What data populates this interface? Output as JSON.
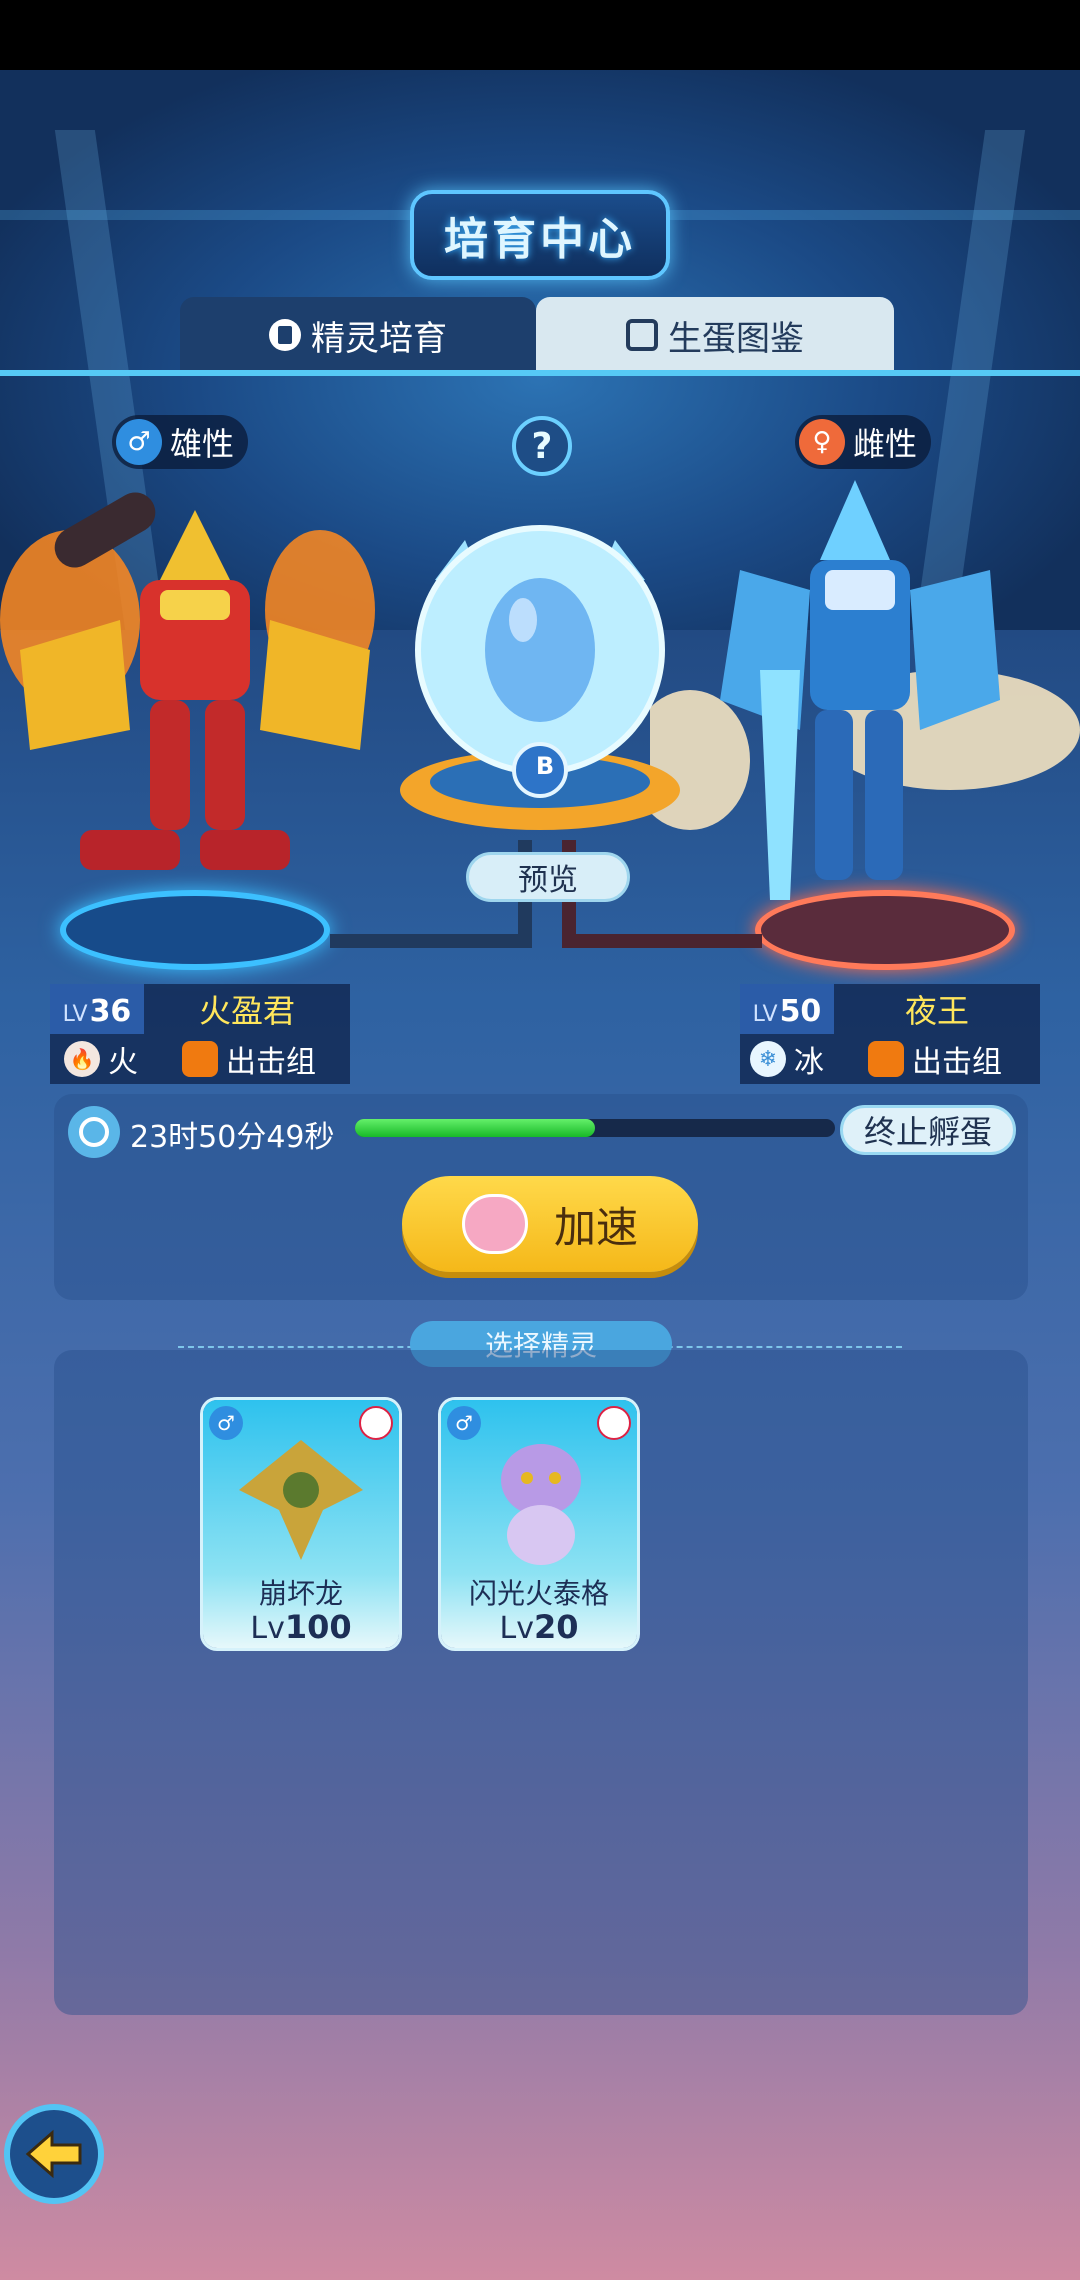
{
  "header": {
    "title": "培育中心"
  },
  "tabs": [
    {
      "label": "精灵培育",
      "active": true,
      "icon": "spirit-icon"
    },
    {
      "label": "生蛋图鉴",
      "active": false,
      "icon": "book-icon"
    }
  ],
  "parents": {
    "male": {
      "gender": "雄性",
      "level_tag": "LV",
      "level": "36",
      "name": "火盈君",
      "element": "火",
      "group": "出击组"
    },
    "female": {
      "gender": "雌性",
      "level_tag": "LV",
      "level": "50",
      "name": "夜王",
      "element": "冰",
      "group": "出击组"
    }
  },
  "center": {
    "help": "?",
    "preview": "预览",
    "egg_badge": "B"
  },
  "hatch": {
    "timer": "23时50分49秒",
    "progress": 0.5,
    "stop": "终止孵蛋",
    "accelerate": "加速"
  },
  "select": {
    "label": "选择精灵",
    "cards": [
      {
        "name": "崩坏龙",
        "lv_prefix": "Lv",
        "level": "100"
      },
      {
        "name": "闪光火泰格",
        "lv_prefix": "Lv",
        "level": "20"
      }
    ]
  },
  "colors": {
    "accent": "#56c9f5",
    "progress": "#2ed13b",
    "accelerate": "#f7c629",
    "name": "#ffe65c"
  }
}
